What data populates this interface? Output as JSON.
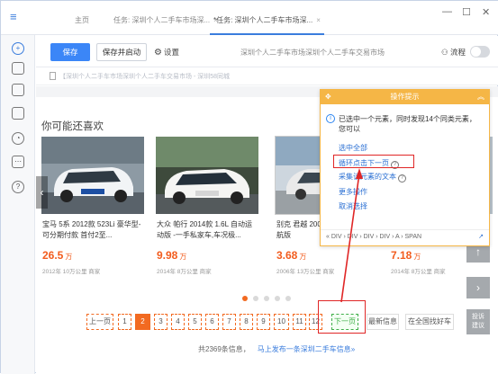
{
  "titlebar": {
    "tabs": [
      {
        "label": "主页"
      },
      {
        "label": "任务: 深圳个人二手车市场深..."
      },
      {
        "label": "*任务: 深圳个人二手车市场深..."
      }
    ],
    "close_glyph": "×"
  },
  "rail": {
    "icons": [
      "plus-icon",
      "file-icon",
      "printer-icon",
      "lock-icon",
      "clock-icon",
      "chat-icon",
      "help-icon"
    ]
  },
  "toolbar": {
    "save_label": "保存",
    "save_run_label": "保存并启动",
    "settings_label": "设置",
    "title": "深圳个人二手车市场深圳个人二手车交易市场",
    "flow_label": "流程"
  },
  "urlbar": {
    "text": "【深圳个人二手车市场深圳个人二手车交易市场 - 深圳58同城"
  },
  "page": {
    "section_title": "你可能还喜欢",
    "cards": [
      {
        "name": "宝马 5系 2012款 523Li 豪华型-可分期付款 首付2至...",
        "price": "26.5",
        "unit": "万",
        "meta": "2012年    10万公里    商家"
      },
      {
        "name": "大众 帕行 2014款 1.6L 自动运动版 -一手私家车,车况极...",
        "price": "9.98",
        "unit": "万",
        "meta": "2014年    8万公里    商家"
      },
      {
        "name": "别克 君越 2008款 2.4L 豪华导航版",
        "price": "3.68",
        "unit": "万",
        "meta": "2006年    13万公里    商家"
      },
      {
        "name": "",
        "price": "7.18",
        "unit": "万",
        "meta": "2014年    8万公里    商家"
      }
    ],
    "pager": {
      "prev": "上一页",
      "pages": [
        "1",
        "2",
        "3",
        "4",
        "5",
        "6",
        "7",
        "8",
        "9",
        "10",
        "11",
        "12"
      ],
      "current": "2",
      "next": "下一页",
      "latest": "最新信息",
      "all_city": "在全国找好车"
    },
    "total_text": "共2369条信息，",
    "post_link": "马上发布一条深圳二手车信息»",
    "side": {
      "up": "↑",
      "next": "›",
      "feedback_l1": "投诉",
      "feedback_l2": "建议"
    }
  },
  "tip": {
    "title": "操作提示",
    "message": "已选中一个元素，同时发现14个同类元素，您可以",
    "actions": [
      {
        "label": "选中全部",
        "help": false
      },
      {
        "label": "循环点击下一页",
        "help": true
      },
      {
        "label": "采集该元素的文本",
        "help": true
      },
      {
        "label": "更多操作",
        "help": false
      },
      {
        "label": "取消选择",
        "help": false
      }
    ],
    "path": "« DIV › DIV › DIV › DIV › A › SPAN"
  },
  "colors": {
    "accent": "#3b86f7",
    "warning": "#f5b646",
    "price": "#f25c1e",
    "highlight": "#e02626",
    "next_green": "#3fae49"
  }
}
